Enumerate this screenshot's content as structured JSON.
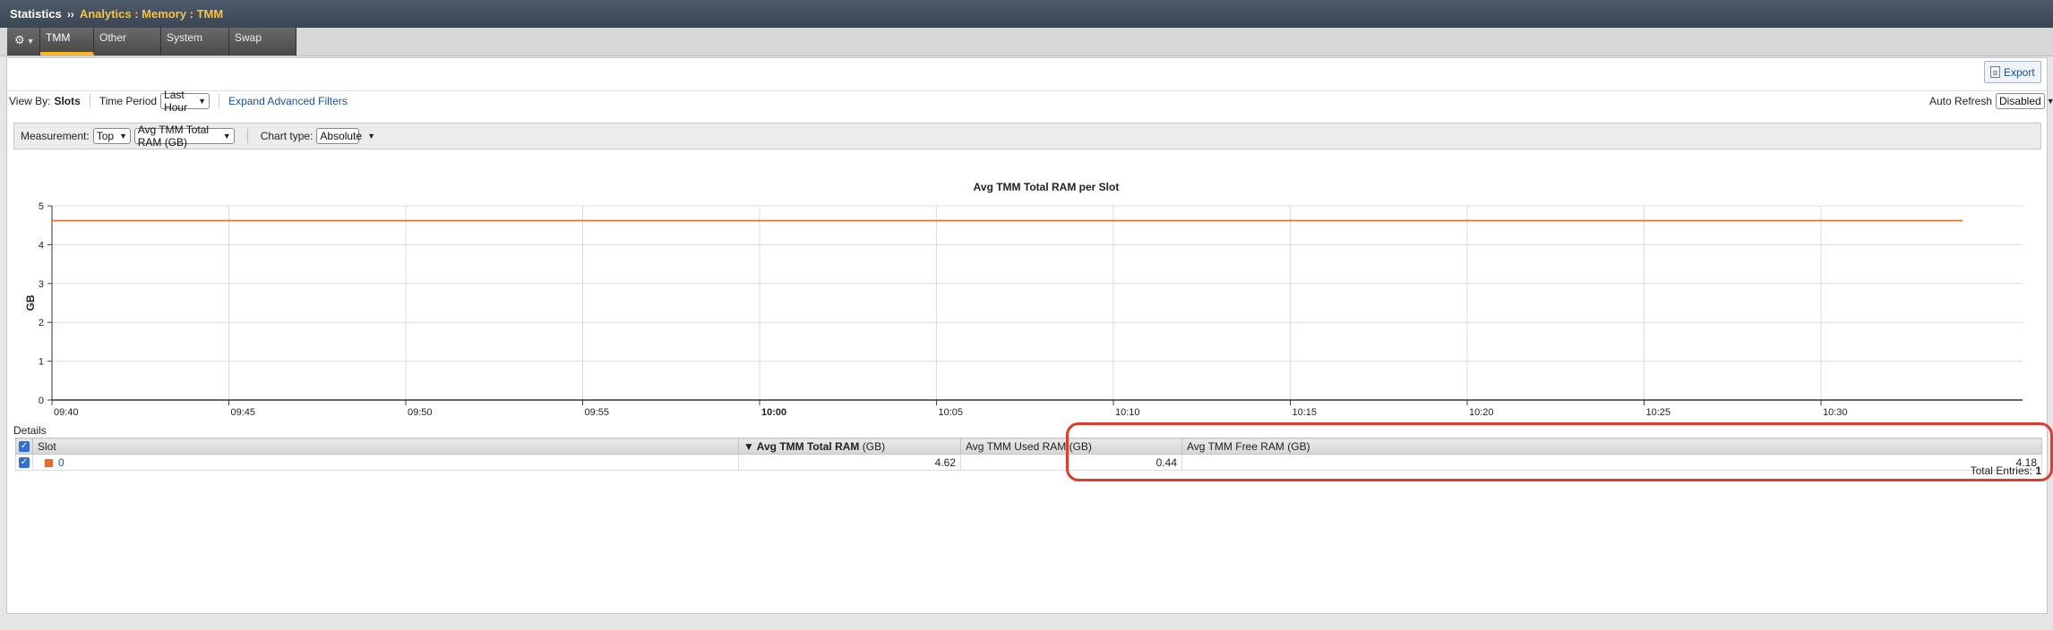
{
  "header": {
    "root": "Statistics",
    "separator": "››",
    "path": "Analytics : Memory : TMM"
  },
  "tabs": [
    {
      "label": "TMM",
      "active": true
    },
    {
      "label": "Other",
      "active": false
    },
    {
      "label": "System",
      "active": false
    },
    {
      "label": "Swap",
      "active": false
    }
  ],
  "toolbar": {
    "export_label": "Export"
  },
  "filters": {
    "view_by_label": "View By:",
    "view_by_value": "Slots",
    "time_period_label": "Time Period",
    "time_period_value": "Last Hour",
    "expand_link": "Expand Advanced Filters",
    "auto_refresh_label": "Auto Refresh",
    "auto_refresh_value": "Disabled"
  },
  "measurement": {
    "label": "Measurement:",
    "mode_value": "Top",
    "metric_value": "Avg TMM Total RAM (GB)",
    "chart_type_label": "Chart type:",
    "chart_type_value": "Absolute"
  },
  "chart_data": {
    "type": "line",
    "title": "Avg TMM Total RAM per Slot",
    "ylabel": "GB",
    "xlabel": "",
    "ylim": [
      0,
      5
    ],
    "yticks": [
      "0",
      "1",
      "2",
      "3",
      "4",
      "5"
    ],
    "xticks": [
      "09:40",
      "09:45",
      "09:50",
      "09:55",
      "10:00",
      "10:05",
      "10:10",
      "10:15",
      "10:20",
      "10:25",
      "10:30"
    ],
    "bold_tick": "10:00",
    "grid": true,
    "series": [
      {
        "color": "#e86a2a",
        "x": [
          "09:40",
          "10:34"
        ],
        "values": [
          4.62,
          4.62
        ]
      }
    ]
  },
  "details": {
    "title": "Details",
    "columns": {
      "slot": "Slot",
      "sort_marker": "▼",
      "total": "Avg TMM Total RAM",
      "total_unit": "(GB)",
      "used": "Avg TMM Used RAM (GB)",
      "free": "Avg TMM Free RAM (GB)"
    },
    "rows": [
      {
        "slot": "0",
        "total": "4.62",
        "used": "0.44",
        "free": "4.18",
        "color": "#e86a2a"
      }
    ],
    "total_label": "Total Entries:",
    "total_value": "1"
  }
}
